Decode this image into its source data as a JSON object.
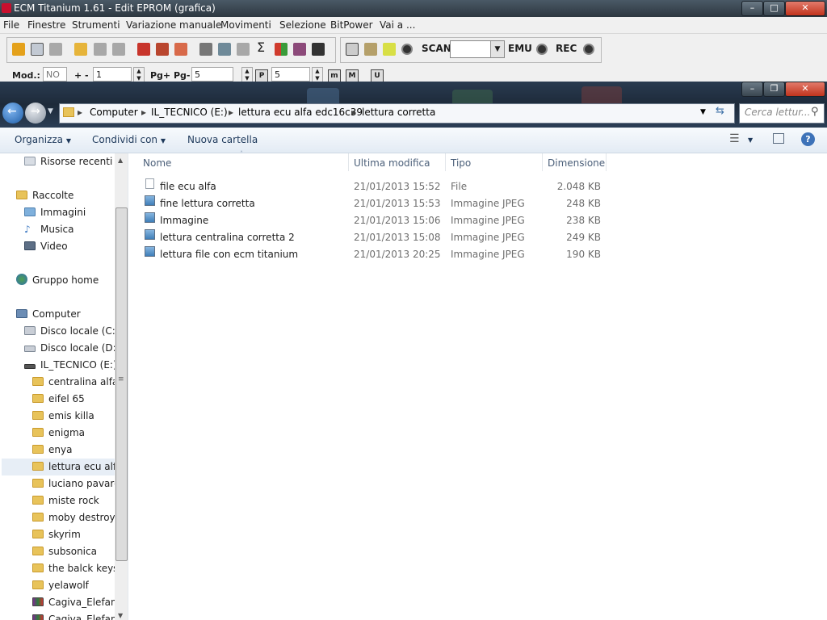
{
  "ecm": {
    "title": "ECM Titanium 1.61 - Edit EPROM (grafica)",
    "menu": [
      "File",
      "Finestre",
      "Strumenti",
      "Variazione manuale",
      "Movimenti",
      "Selezione",
      "BitPower",
      "Vai a ..."
    ],
    "toolbar": {
      "scan": "SCAN",
      "emu": "EMU",
      "rec": "REC"
    },
    "row2": {
      "mod_label": "Mod.:",
      "mod_value": "NO",
      "plusminus": "+ -",
      "step_value": "1",
      "pg_label": "Pg+ Pg-",
      "pg_value": "5",
      "p_value": "5",
      "p_icon": "P",
      "m_icon": "m",
      "mm_icon": "M",
      "u_icon": "U"
    }
  },
  "explorer": {
    "breadcrumb": [
      "Computer",
      "IL_TECNICO (E:)",
      "lettura ecu alfa edc16c39",
      "lettura corretta"
    ],
    "search_placeholder": "Cerca lettur...",
    "commands": {
      "organize": "Organizza",
      "share": "Condividi con",
      "new_folder": "Nuova cartella"
    },
    "nav": [
      {
        "label": "Risorse recenti",
        "icon": "recent-icon"
      },
      {
        "label": "Raccolte",
        "icon": "libraries-icon"
      },
      {
        "label": "Immagini",
        "icon": "pictures-icon"
      },
      {
        "label": "Musica",
        "icon": "music-icon"
      },
      {
        "label": "Video",
        "icon": "video-icon"
      },
      {
        "label": "Gruppo home",
        "icon": "homegroup-icon"
      },
      {
        "label": "Computer",
        "icon": "computer-icon"
      },
      {
        "label": "Disco locale (C:)",
        "icon": "drive-icon"
      },
      {
        "label": "Disco locale (D:)",
        "icon": "drive-icon"
      },
      {
        "label": "IL_TECNICO (E:)",
        "icon": "usb-drive-icon"
      },
      {
        "label": "centralina alfa",
        "icon": "folder-icon"
      },
      {
        "label": "eifel 65",
        "icon": "folder-icon"
      },
      {
        "label": "emis killa",
        "icon": "folder-icon"
      },
      {
        "label": "enigma",
        "icon": "folder-icon"
      },
      {
        "label": "enya",
        "icon": "folder-icon"
      },
      {
        "label": "lettura ecu alfa",
        "icon": "folder-icon"
      },
      {
        "label": "luciano pavaro",
        "icon": "folder-icon"
      },
      {
        "label": "miste rock",
        "icon": "folder-icon"
      },
      {
        "label": "moby destroye",
        "icon": "folder-icon"
      },
      {
        "label": "skyrim",
        "icon": "folder-icon"
      },
      {
        "label": "subsonica",
        "icon": "folder-icon"
      },
      {
        "label": "the balck keys",
        "icon": "folder-icon"
      },
      {
        "label": "yelawolf",
        "icon": "folder-icon"
      },
      {
        "label": "Cagiva_Elefant_",
        "icon": "archive-icon"
      },
      {
        "label": "Cagiva_Elefant_",
        "icon": "archive-icon"
      }
    ],
    "columns": {
      "name": "Nome",
      "modified": "Ultima modifica",
      "type": "Tipo",
      "size": "Dimensione"
    },
    "files": [
      {
        "name": "file ecu alfa",
        "modified": "21/01/2013 15:52",
        "type": "File",
        "size": "2.048 KB",
        "icon": "file-icon"
      },
      {
        "name": "fine lettura corretta",
        "modified": "21/01/2013 15:53",
        "type": "Immagine JPEG",
        "size": "248 KB",
        "icon": "image-icon"
      },
      {
        "name": "Immagine",
        "modified": "21/01/2013 15:06",
        "type": "Immagine JPEG",
        "size": "238 KB",
        "icon": "image-icon"
      },
      {
        "name": "lettura centralina corretta 2",
        "modified": "21/01/2013 15:08",
        "type": "Immagine JPEG",
        "size": "249 KB",
        "icon": "image-icon"
      },
      {
        "name": "lettura file con ecm titanium",
        "modified": "21/01/2013 20:25",
        "type": "Immagine JPEG",
        "size": "190 KB",
        "icon": "image-icon"
      }
    ]
  }
}
